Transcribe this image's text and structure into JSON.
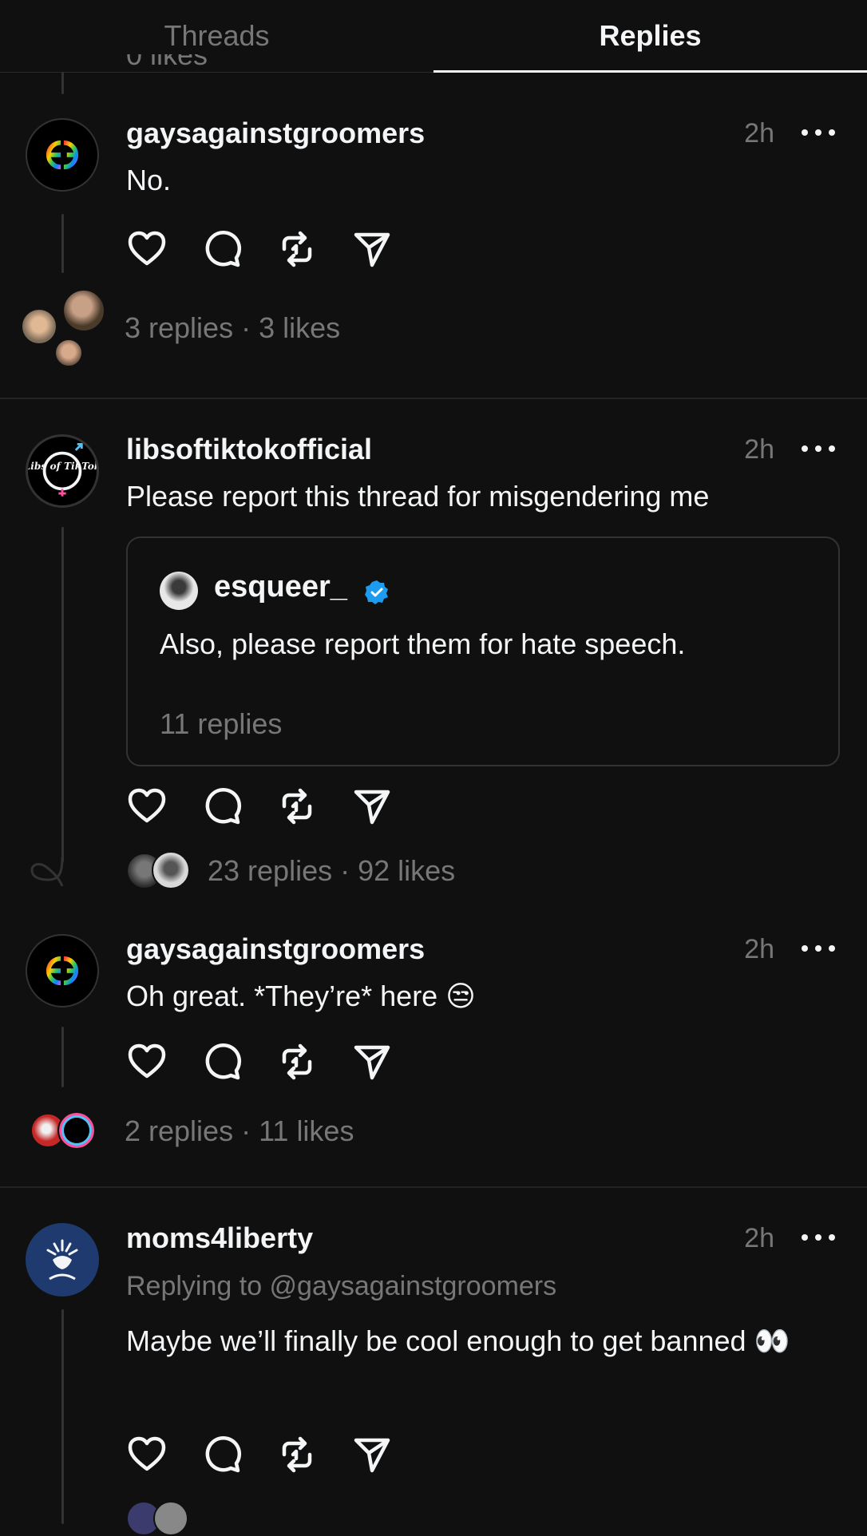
{
  "tabs": {
    "threads": "Threads",
    "replies": "Replies",
    "active": "replies"
  },
  "clipped_above": "0 likes",
  "posts": [
    {
      "username": "gaysagainstgroomers",
      "time": "2h",
      "text": "No.",
      "meta": "3 replies · 3 likes"
    },
    {
      "username": "libsoftiktokofficial",
      "time": "2h",
      "text": "Please report this thread for misgendering me",
      "avatar_label": "Libs of TikTok",
      "quote": {
        "username": "esqueer_",
        "text": "Also, please report them for hate speech.",
        "replies": "11 replies"
      },
      "meta": "23 replies · 92 likes"
    },
    {
      "username": "gaysagainstgroomers",
      "time": "2h",
      "text": "Oh great. *They’re* here 😒",
      "meta": "2 replies · 11 likes"
    },
    {
      "username": "moms4liberty",
      "time": "2h",
      "reply_to": "Replying to @gaysagainstgroomers",
      "text": "Maybe we’ll finally be cool enough to get banned 👀"
    }
  ],
  "colors": {
    "background": "#101010",
    "text": "#f3f5f7",
    "muted": "#777777",
    "verified": "#1d9bf0"
  }
}
